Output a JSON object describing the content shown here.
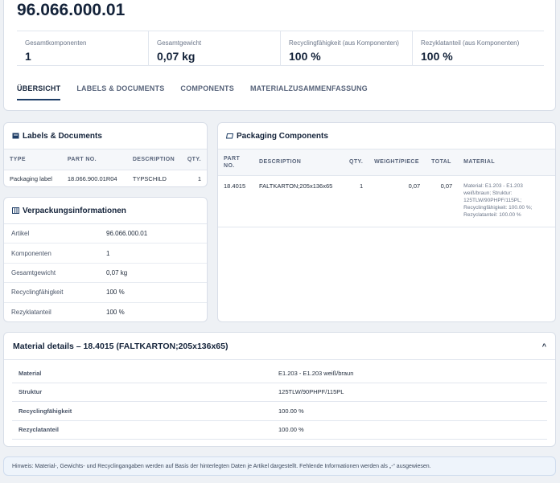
{
  "header": {
    "part_number": "96.066.000.01",
    "stats": [
      {
        "label": "Gesamtkomponenten",
        "value": "1"
      },
      {
        "label": "Gesamtgewicht",
        "value": "0,07 kg"
      },
      {
        "label": "Recyclingfähigkeit (aus Komponenten)",
        "value": "100 %"
      },
      {
        "label": "Rezyklatanteil (aus Komponenten)",
        "value": "100 %"
      }
    ],
    "tabs": [
      "ÜBERSICHT",
      "LABELS & DOCUMENTS",
      "COMPONENTS",
      "MATERIALZUSAMMENFASSUNG"
    ],
    "active_tab": 0
  },
  "labels": {
    "title": "Labels & Documents",
    "icon": "document-icon",
    "columns": [
      "TYPE",
      "PART NO.",
      "DESCRIPTION",
      "QTY."
    ],
    "rows": [
      {
        "type": "Packaging label",
        "part_no": "18.066.900.01R04",
        "description": "TYPSCHILD",
        "qty": "1"
      }
    ]
  },
  "verpackung": {
    "title": "Verpackungsinformationen",
    "icon": "columns-icon",
    "rows": [
      {
        "key": "Artikel",
        "value": "96.066.000.01"
      },
      {
        "key": "Komponenten",
        "value": "1"
      },
      {
        "key": "Gesamtgewicht",
        "value": "0,07 kg"
      },
      {
        "key": "Recyclingfähigkeit",
        "value": "100 %"
      },
      {
        "key": "Rezyklatanteil",
        "value": "100 %"
      }
    ]
  },
  "packaging": {
    "title": "Packaging Components",
    "icon": "box-icon",
    "columns": [
      "PART NO.",
      "DESCRIPTION",
      "QTY.",
      "WEIGHT/PIECE",
      "TOTAL",
      "MATERIAL"
    ],
    "rows": [
      {
        "part_no": "18.4015",
        "description": "FALTKARTON;205x136x65",
        "qty": "1",
        "weight": "0,07",
        "total": "0,07",
        "material": "Material: E1.203 - E1.203 weiß/braun; Struktur: 125TLW/90PHPF/115PL; Recyclingfähigkeit: 100.00 %; Rezyclatanteil: 100.00 %"
      }
    ]
  },
  "details": {
    "title": "Material details – 18.4015 (FALTKARTON;205x136x65)",
    "collapse_symbol": "^",
    "rows": [
      {
        "key": "Material",
        "value": "E1.203 - E1.203 weiß/braun"
      },
      {
        "key": "Struktur",
        "value": "125TLW/90PHPF/115PL"
      },
      {
        "key": "Recyclingfähigkeit",
        "value": "100.00 %"
      },
      {
        "key": "Rezyclatanteil",
        "value": "100.00 %"
      }
    ]
  },
  "hint": {
    "text": "Hinweis: Material-, Gewichts- und Recyclingangaben werden auf Basis der hinterlegten Daten je Artikel dargestellt. Fehlende Informationen werden als „-“ ausgewiesen."
  },
  "colors": {
    "accent": "#1e3d66",
    "border": "#d8dee8",
    "hint_bg": "#eef4fb"
  }
}
